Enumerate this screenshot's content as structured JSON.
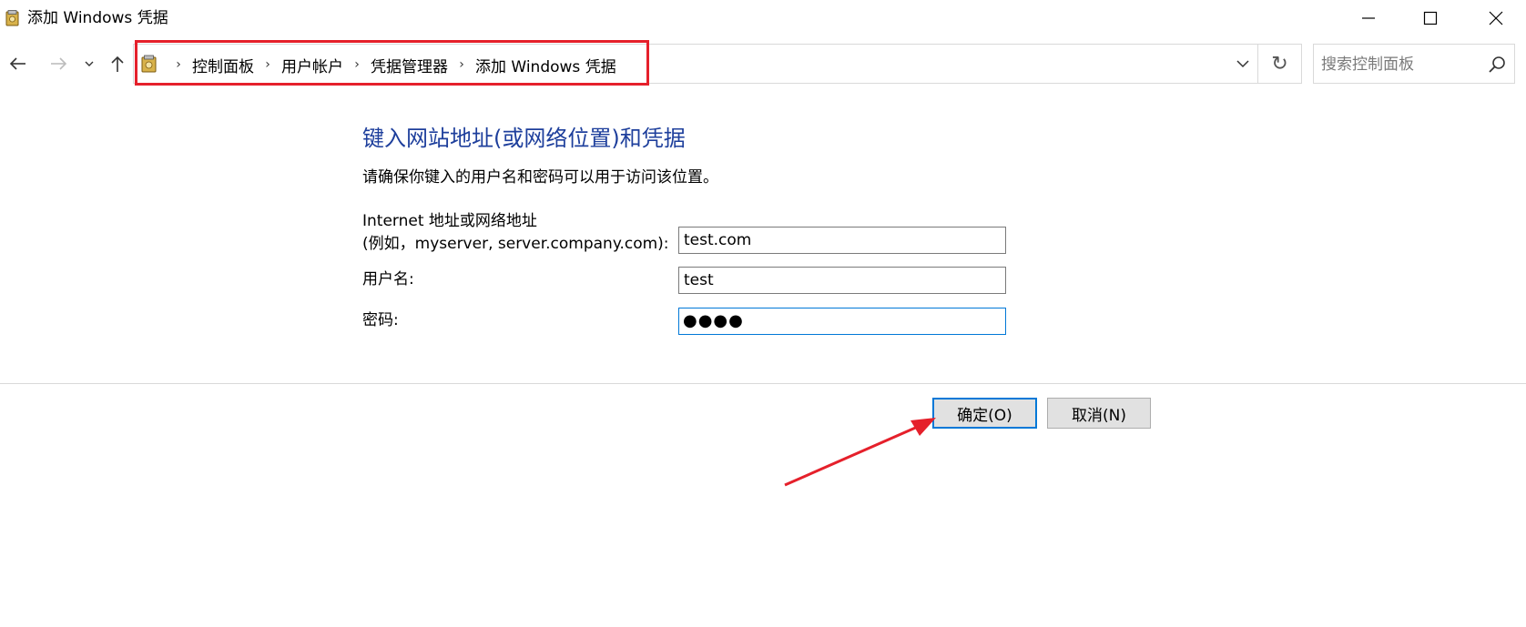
{
  "window": {
    "title": "添加 Windows 凭据",
    "minimize_icon": "minimize-icon",
    "maximize_icon": "maximize-icon",
    "close_icon": "close-icon"
  },
  "nav": {
    "back_icon": "arrow-left-icon",
    "forward_icon": "arrow-right-icon",
    "recent_icon": "chevron-down-icon",
    "up_icon": "arrow-up-icon",
    "refresh_symbol": "↻"
  },
  "breadcrumb": {
    "items": [
      "控制面板",
      "用户帐户",
      "凭据管理器",
      "添加 Windows 凭据"
    ],
    "separator": "›"
  },
  "search": {
    "placeholder": "搜索控制面板"
  },
  "form": {
    "heading": "键入网站地址(或网络位置)和凭据",
    "subtext": "请确保你键入的用户名和密码可以用于访问该位置。",
    "address_label_line1": "Internet 地址或网络地址",
    "address_label_line2": "(例如，myserver, server.company.com):",
    "address_value": "test.com",
    "username_label": "用户名:",
    "username_value": "test",
    "password_label": "密码:",
    "password_mask": "●●●●"
  },
  "buttons": {
    "ok_label": "确定(O)",
    "cancel_label": "取消(N)"
  },
  "colors": {
    "heading": "#1e3f9c",
    "annotation": "#e5202b",
    "focus": "#0078d7"
  }
}
